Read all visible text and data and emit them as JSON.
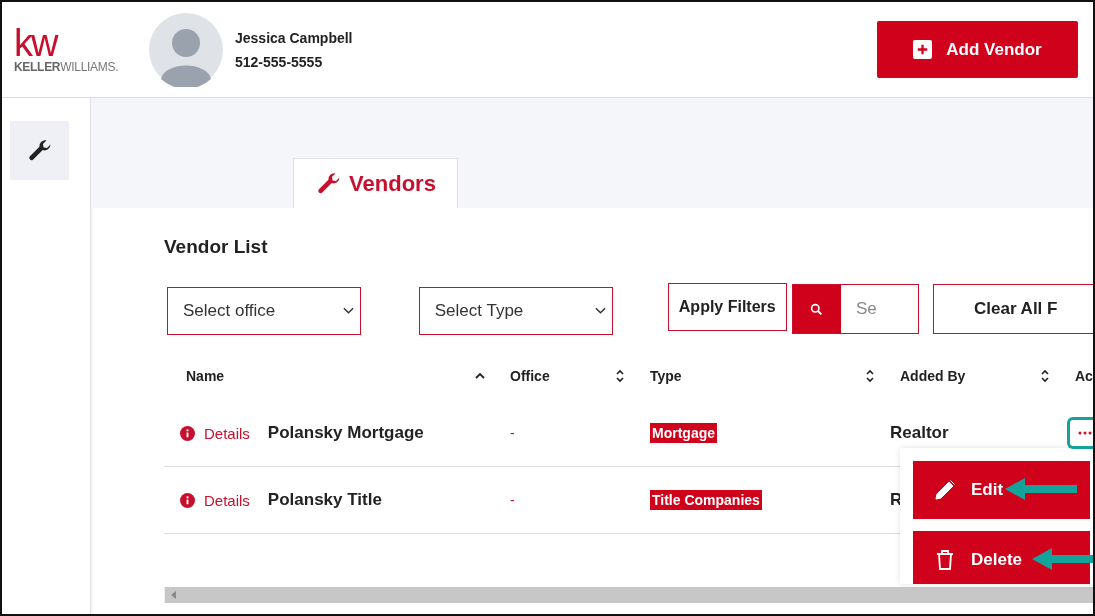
{
  "header": {
    "logo": {
      "mark": "kw",
      "brand_bold": "KELLER",
      "brand_light": "WILLIAMS."
    },
    "user": {
      "name": "Jessica Campbell",
      "phone": "512-555-5555"
    },
    "add_button": "Add Vendor"
  },
  "tabs": [
    {
      "label": "Vendors",
      "selected": true
    }
  ],
  "section_title": "Vendor List",
  "filters": {
    "office": {
      "placeholder": "Select office"
    },
    "type": {
      "placeholder": "Select Type"
    },
    "apply_button": "Apply Filters",
    "search": {
      "placeholder": "Se"
    },
    "clear_button": "Clear All F"
  },
  "table": {
    "columns": [
      {
        "label": "Name",
        "sorted": true
      },
      {
        "label": "Office",
        "sorted": false
      },
      {
        "label": "Type",
        "sorted": false
      },
      {
        "label": "Added By",
        "sorted": false
      },
      {
        "label": "Ac"
      }
    ],
    "rows": [
      {
        "details": "Details",
        "name": "Polansky Mortgage",
        "office": "-",
        "type": "Mortgage",
        "added_by": "Realtor",
        "menu_open": true
      },
      {
        "details": "Details",
        "name": "Polansky Title",
        "office": "-",
        "type": "Title Companies",
        "added_by": "R",
        "menu_open": false
      }
    ]
  },
  "action_menu": {
    "items": [
      {
        "kind": "edit",
        "label": "Edit"
      },
      {
        "kind": "delete",
        "label": "Delete"
      }
    ]
  }
}
